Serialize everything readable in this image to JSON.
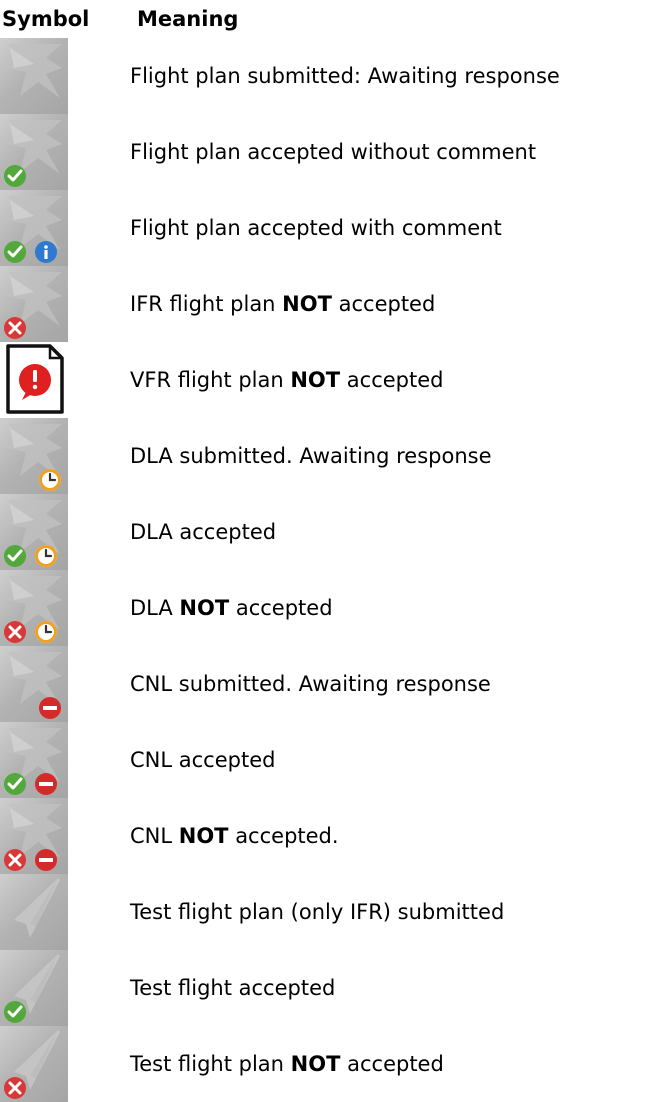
{
  "header": {
    "symbol": "Symbol",
    "meaning": "Meaning"
  },
  "rows": [
    {
      "icon": "plane-icon",
      "badges": [],
      "meaning": {
        "pre": "Flight plan submitted: Awaiting response",
        "bold": "",
        "post": ""
      }
    },
    {
      "icon": "plane-icon",
      "badges": [
        "check-badge-icon"
      ],
      "meaning": {
        "pre": "Flight plan accepted without comment",
        "bold": "",
        "post": ""
      }
    },
    {
      "icon": "plane-icon",
      "badges": [
        "check-badge-icon",
        "info-badge-icon"
      ],
      "meaning": {
        "pre": "Flight plan accepted with comment",
        "bold": "",
        "post": ""
      }
    },
    {
      "icon": "plane-icon",
      "badges": [
        "cross-badge-icon"
      ],
      "meaning": {
        "pre": "IFR flight plan ",
        "bold": "NOT",
        "post": " accepted"
      }
    },
    {
      "icon": "document-alert-icon",
      "badges": [],
      "meaning": {
        "pre": "VFR flight plan ",
        "bold": "NOT",
        "post": " accepted"
      }
    },
    {
      "icon": "plane-icon",
      "badges": [
        "clock-badge-icon"
      ],
      "meaning": {
        "pre": "DLA submitted. Awaiting response",
        "bold": "",
        "post": ""
      }
    },
    {
      "icon": "plane-icon",
      "badges": [
        "check-badge-icon",
        "clock-badge-icon"
      ],
      "meaning": {
        "pre": "DLA accepted",
        "bold": "",
        "post": ""
      }
    },
    {
      "icon": "plane-icon",
      "badges": [
        "cross-badge-icon",
        "clock-badge-icon"
      ],
      "meaning": {
        "pre": "DLA ",
        "bold": "NOT",
        "post": " accepted"
      }
    },
    {
      "icon": "plane-icon",
      "badges": [
        "minus-badge-icon"
      ],
      "meaning": {
        "pre": "CNL submitted. Awaiting response",
        "bold": "",
        "post": ""
      }
    },
    {
      "icon": "plane-icon",
      "badges": [
        "check-badge-icon",
        "minus-badge-icon"
      ],
      "meaning": {
        "pre": "CNL accepted",
        "bold": "",
        "post": ""
      }
    },
    {
      "icon": "plane-icon",
      "badges": [
        "cross-badge-icon",
        "minus-badge-icon"
      ],
      "meaning": {
        "pre": "CNL ",
        "bold": "NOT",
        "post": " accepted."
      }
    },
    {
      "icon": "test-plane-icon",
      "badges": [],
      "meaning": {
        "pre": "Test flight plan (only IFR) submitted",
        "bold": "",
        "post": ""
      }
    },
    {
      "icon": "test-plane-icon",
      "badges": [
        "check-badge-icon"
      ],
      "meaning": {
        "pre": "Test flight accepted",
        "bold": "",
        "post": ""
      }
    },
    {
      "icon": "test-plane-icon",
      "badges": [
        "cross-badge-icon"
      ],
      "meaning": {
        "pre": "Test flight plan ",
        "bold": "NOT",
        "post": " accepted"
      }
    }
  ],
  "colors": {
    "check": "#52a83a",
    "cross": "#d93838",
    "info": "#2f79d0",
    "clock": "#f0a020",
    "minus": "#d42a2a",
    "alert": "#e02020"
  }
}
